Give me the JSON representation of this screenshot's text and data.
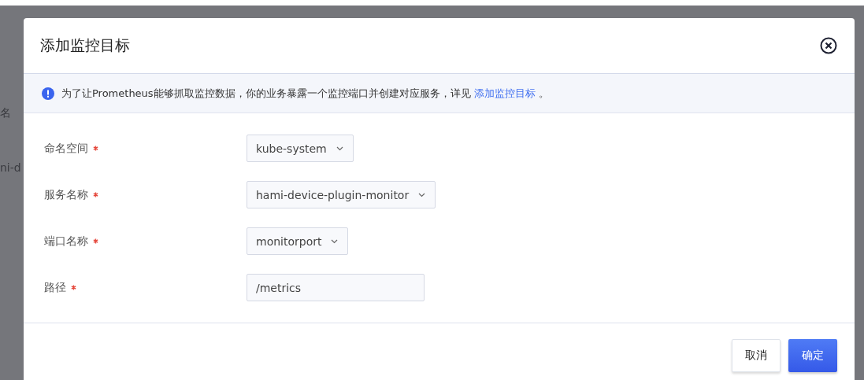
{
  "background": {
    "texts": [
      "名",
      "ni-d"
    ]
  },
  "dialog": {
    "title": "添加监控目标",
    "notice": {
      "text": "为了让Prometheus能够抓取监控数据，你的业务暴露一个监控端口并创建对应服务，详见",
      "link": "添加监控目标",
      "suffix": "。"
    },
    "fields": [
      {
        "label": "命名空间",
        "required": true,
        "kind": "select",
        "value": "kube-system"
      },
      {
        "label": "服务名称",
        "required": true,
        "kind": "select",
        "value": "hami-device-plugin-monitor"
      },
      {
        "label": "端口名称",
        "required": true,
        "kind": "select",
        "value": "monitorport"
      },
      {
        "label": "路径",
        "required": true,
        "kind": "input",
        "value": "/metrics"
      }
    ],
    "buttons": [
      {
        "label": "取消",
        "kind": "secondary"
      },
      {
        "label": "确定",
        "kind": "primary"
      }
    ]
  }
}
